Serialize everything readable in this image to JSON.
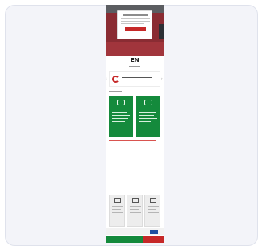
{
  "page": {
    "logo_text": "EN",
    "hero_color": "#8a2c33",
    "accent_green": "#148a3c",
    "accent_red": "#c62828",
    "dialog_button_color": "#c62828"
  },
  "icons": {
    "banner": "ring-logo-icon",
    "card_left": "card-icon",
    "card_right": "card-icon",
    "tiles": [
      "phone-icon",
      "screen-icon",
      "document-icon"
    ],
    "footer": "eu-flag-icon"
  },
  "arrows": {
    "prev": "‹",
    "next": "›"
  }
}
